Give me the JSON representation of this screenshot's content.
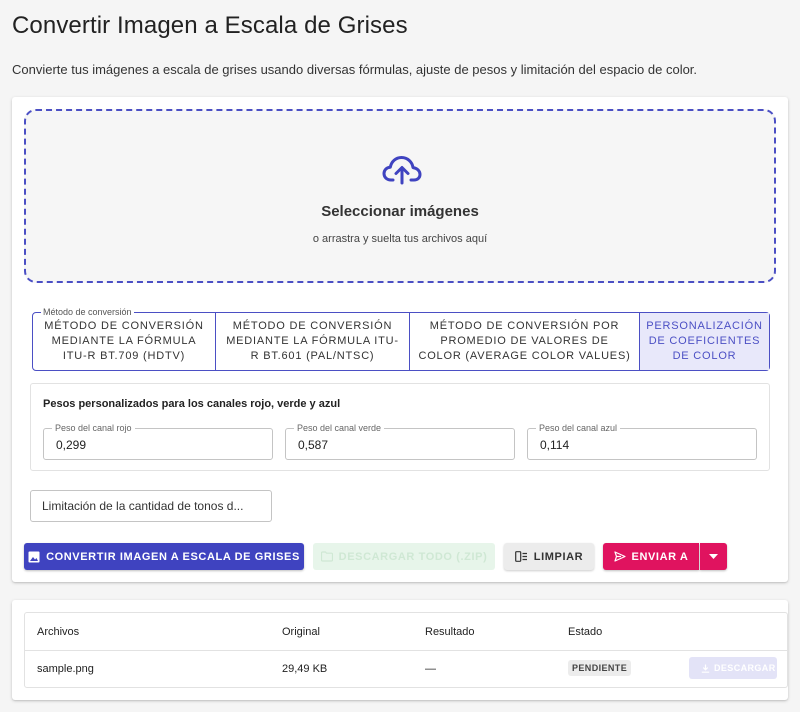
{
  "page": {
    "title": "Convertir Imagen a Escala de Grises",
    "description": "Convierte tus imágenes a escala de grises usando diversas fórmulas, ajuste de pesos y limitación del espacio de color."
  },
  "upload": {
    "icon": "cloud-upload-icon",
    "title": "Seleccionar imágenes",
    "subtitle": "o arrastra y suelta tus archivos aquí"
  },
  "method": {
    "legend": "Método de conversión",
    "options": [
      "MÉTODO DE CONVERSIÓN MEDIANTE LA FÓRMULA ITU-R BT.709 (HDTV)",
      "MÉTODO DE CONVERSIÓN MEDIANTE LA FÓRMULA ITU-R BT.601 (PAL/NTSC)",
      "MÉTODO DE CONVERSIÓN POR PROMEDIO DE VALORES DE COLOR (AVERAGE COLOR VALUES)",
      "PERSONALIZACIÓN DE COEFICIENTES DE COLOR"
    ],
    "selected_index": 3
  },
  "weights": {
    "title": "Pesos personalizados para los canales rojo, verde y azul",
    "red": {
      "label": "Peso del canal rojo",
      "value": "0,299"
    },
    "green": {
      "label": "Peso del canal verde",
      "value": "0,587"
    },
    "blue": {
      "label": "Peso del canal azul",
      "value": "0,114"
    }
  },
  "limit_select": {
    "value": "Limitación de la cantidad de tonos d..."
  },
  "actions": {
    "convert_label": "CONVERTIR IMAGEN A ESCALA DE GRISES",
    "zip_label": "DESCARGAR TODO (.ZIP)",
    "clear_label": "LIMPIAR",
    "send_label": "ENVIAR A"
  },
  "files": {
    "headers": [
      "Archivos",
      "Original",
      "Resultado",
      "Estado"
    ],
    "rows": [
      {
        "name": "sample.png",
        "original": "29,49 KB",
        "result": "—",
        "status": "PENDIENTE",
        "download_label": "DESCARGAR"
      }
    ]
  },
  "colors": {
    "primary": "#3f43c0",
    "accent": "#e0135f",
    "selected_bg": "#e8e8fa",
    "disabled_green": "#e7f5ea"
  }
}
